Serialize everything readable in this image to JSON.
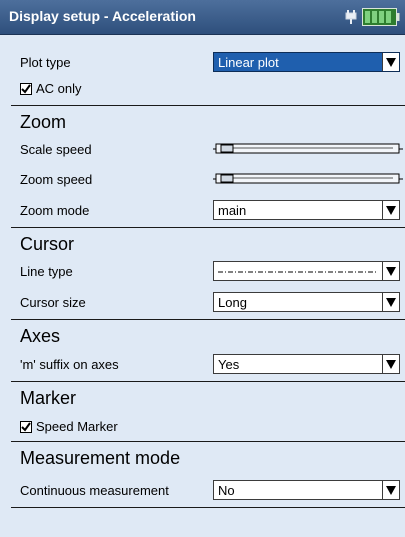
{
  "window": {
    "title": "Display setup - Acceleration"
  },
  "icons": {
    "plug": "plug-icon",
    "battery": "battery-icon"
  },
  "colors": {
    "background": "#dfe9f5",
    "titlebar": "#2e4f7c",
    "selected": "#1f5fae",
    "battery": "#3aa43a"
  },
  "plot_type": {
    "label": "Plot type",
    "value": "Linear plot"
  },
  "ac_only": {
    "label": "AC only",
    "checked": true
  },
  "zoom": {
    "header": "Zoom",
    "scale_speed": {
      "label": "Scale speed",
      "level": 0.1
    },
    "zoom_speed": {
      "label": "Zoom speed",
      "level": 0.1
    },
    "zoom_mode": {
      "label": "Zoom mode",
      "value": "main"
    }
  },
  "cursor": {
    "header": "Cursor",
    "line_type": {
      "label": "Line type",
      "value": "dash-dot"
    },
    "cursor_size": {
      "label": "Cursor size",
      "value": "Long"
    }
  },
  "axes": {
    "header": "Axes",
    "m_suffix": {
      "label": "'m' suffix on axes",
      "value": "Yes"
    }
  },
  "marker": {
    "header": "Marker",
    "speed_marker": {
      "label": "Speed Marker",
      "checked": true
    }
  },
  "measurement_mode": {
    "header": "Measurement mode",
    "continuous": {
      "label": "Continuous measurement",
      "value": "No"
    }
  }
}
